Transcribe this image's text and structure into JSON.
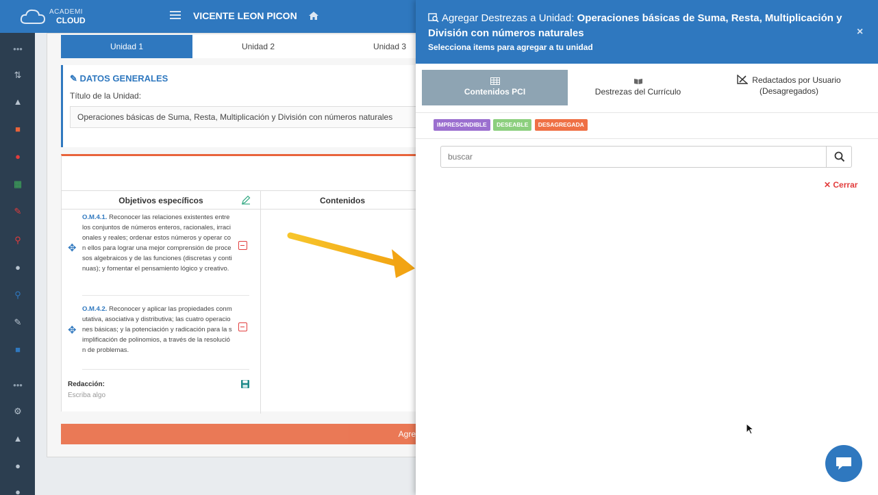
{
  "header": {
    "brand_top": "ACADEMI",
    "brand_bottom": "CLOUD",
    "user_name": "VICENTE LEON PICON"
  },
  "main": {
    "tabs": [
      {
        "label": "Unidad 1",
        "active": true
      },
      {
        "label": "Unidad 2",
        "active": false
      },
      {
        "label": "Unidad 3",
        "active": false
      }
    ],
    "datos": {
      "heading": "DATOS GENERALES",
      "title_label": "Título de la Unidad:",
      "title_value": "Operaciones básicas de Suma, Resta, Multiplicación y División con números naturales"
    },
    "columns": {
      "objetivos": "Objetivos específicos",
      "contenidos": "Contenidos"
    },
    "objectives": [
      {
        "code": "O.M.4.1.",
        "text": "Reconocer las relaciones existentes entre los conjuntos de números enteros, racionales, irracionales y reales; ordenar estos números y operar con ellos para lograr una mejor comprensión de procesos algebraicos y de las funciones (discretas y continuas); y fomentar el pensamiento lógico y creativo."
      },
      {
        "code": "O.M.4.2.",
        "text": "Reconocer y aplicar las propiedades conmutativa, asociativa y distributiva; las cuatro operaciones básicas; y la potenciación y radicación para la simplificación de polinomios, a través de la resolución de problemas."
      }
    ],
    "redaccion": {
      "label": "Redacción:",
      "placeholder": "Escriba algo"
    },
    "agregar_label": "Agre"
  },
  "modal": {
    "title_prefix": "Agregar Destrezas a Unidad:",
    "title_unit": "Operaciones básicas de Suma, Resta, Multiplicación y División con números naturales",
    "subtitle": "Selecciona items para agregar a tu unidad",
    "close_symbol": "×",
    "tabs": [
      {
        "label": "Contenidos PCI",
        "active": true
      },
      {
        "label": "Destrezas del Currículo",
        "active": false
      },
      {
        "label_line1": "Redactados por Usuario",
        "label_line2": "(Desagregados)",
        "active": false
      }
    ],
    "badges": [
      {
        "label": "IMPRESCINDIBLE",
        "color": "#9b6fcf"
      },
      {
        "label": "DESEABLE",
        "color": "#8ccf7e"
      },
      {
        "label": "DESAGREGADA",
        "color": "#ef7045"
      }
    ],
    "search_placeholder": "buscar",
    "cerrar_label": "Cerrar"
  },
  "colors": {
    "primary": "#2f78bf",
    "accent": "#e8633a",
    "sidebar": "#2c3e50",
    "danger": "#e23c3c"
  }
}
